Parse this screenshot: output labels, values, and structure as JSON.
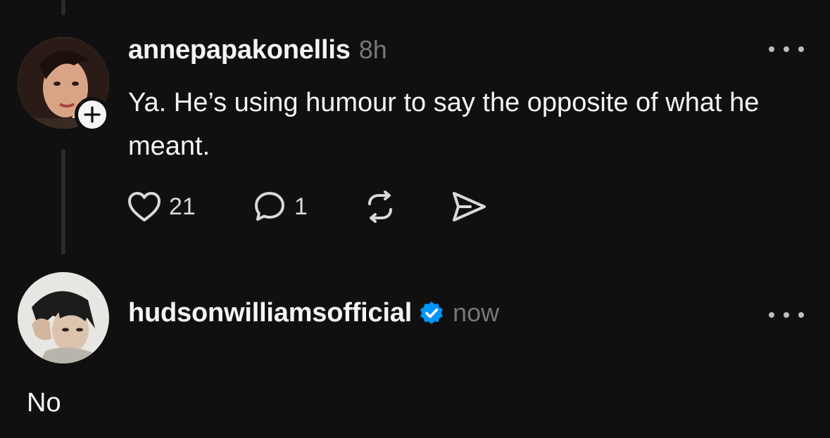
{
  "post": {
    "username": "annepapakonellis",
    "timestamp": "8h",
    "text": "Ya. He’s using humour to say the opposite of what he meant.",
    "likes": "21",
    "replies": "1"
  },
  "reply": {
    "username": "hudsonwilliamsofficial",
    "timestamp": "now",
    "verified": true,
    "draft_text": "No"
  },
  "colors": {
    "background": "#101010",
    "text": "#f3f5f7",
    "muted": "#777777",
    "verified": "#0095f6"
  },
  "icons": [
    "plus-icon",
    "more-icon",
    "heart-icon",
    "comment-icon",
    "repost-icon",
    "send-icon",
    "verified-badge-icon"
  ]
}
